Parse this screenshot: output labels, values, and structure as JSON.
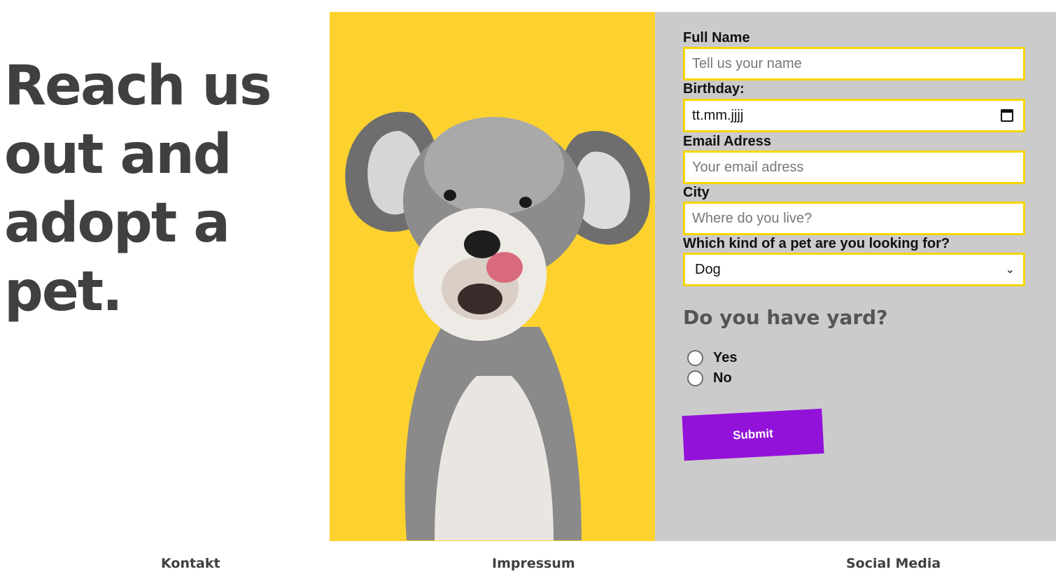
{
  "hero": {
    "title": "Reach us out and adopt a pet."
  },
  "form": {
    "full_name": {
      "label": "Full Name",
      "placeholder": "Tell us your name"
    },
    "birthday": {
      "label": "Birthday:",
      "value": "tt.mm.jjjj"
    },
    "email": {
      "label": "Email Adress",
      "placeholder": "Your email adress"
    },
    "city": {
      "label": "City",
      "placeholder": "Where do you live?"
    },
    "pet": {
      "label": "Which kind of a pet are you looking for?",
      "selected": "Dog"
    },
    "yard": {
      "question": "Do you have yard?",
      "options": [
        "Yes",
        "No"
      ]
    },
    "submit_label": "Submit"
  },
  "footer": {
    "links": [
      "Kontakt",
      "Impressum",
      "Social Media"
    ]
  },
  "colors": {
    "photo_bg": "#fdd22f",
    "panel_bg": "#cbcbcb",
    "field_border": "#f6d600",
    "submit_bg": "#9312d9",
    "heading": "#404040"
  },
  "icons": {
    "date_picker": "calendar-icon",
    "select": "chevron-down-icon"
  }
}
